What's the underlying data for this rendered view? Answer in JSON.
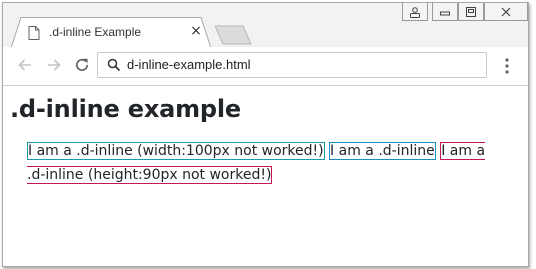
{
  "browser": {
    "tab_title": ".d-inline Example",
    "url": "d-inline-example.html",
    "close_glyph": "×",
    "menu_glyph": "⋮"
  },
  "page": {
    "heading": ".d-inline example",
    "boxes": [
      {
        "text": "I am a .d-inline (width:100px not worked!)",
        "border_color": "#1b9aaa"
      },
      {
        "text": "I am a .d-inline",
        "border_color": "#1a8fc4"
      },
      {
        "text": "I am a .d-inline (height:90px not worked!)",
        "border_color": "#c2185b"
      }
    ]
  },
  "icons": {
    "tab": "document-icon",
    "tab_close": "close-icon",
    "new_tab": "new-tab-icon",
    "profile": "user-icon",
    "minimize": "minimize-icon",
    "restore": "restore-icon",
    "close_window": "close-window-icon",
    "back": "arrow-left-icon",
    "forward": "arrow-right-icon",
    "reload": "reload-icon",
    "search": "search-icon",
    "menu": "kebab-menu-icon"
  }
}
